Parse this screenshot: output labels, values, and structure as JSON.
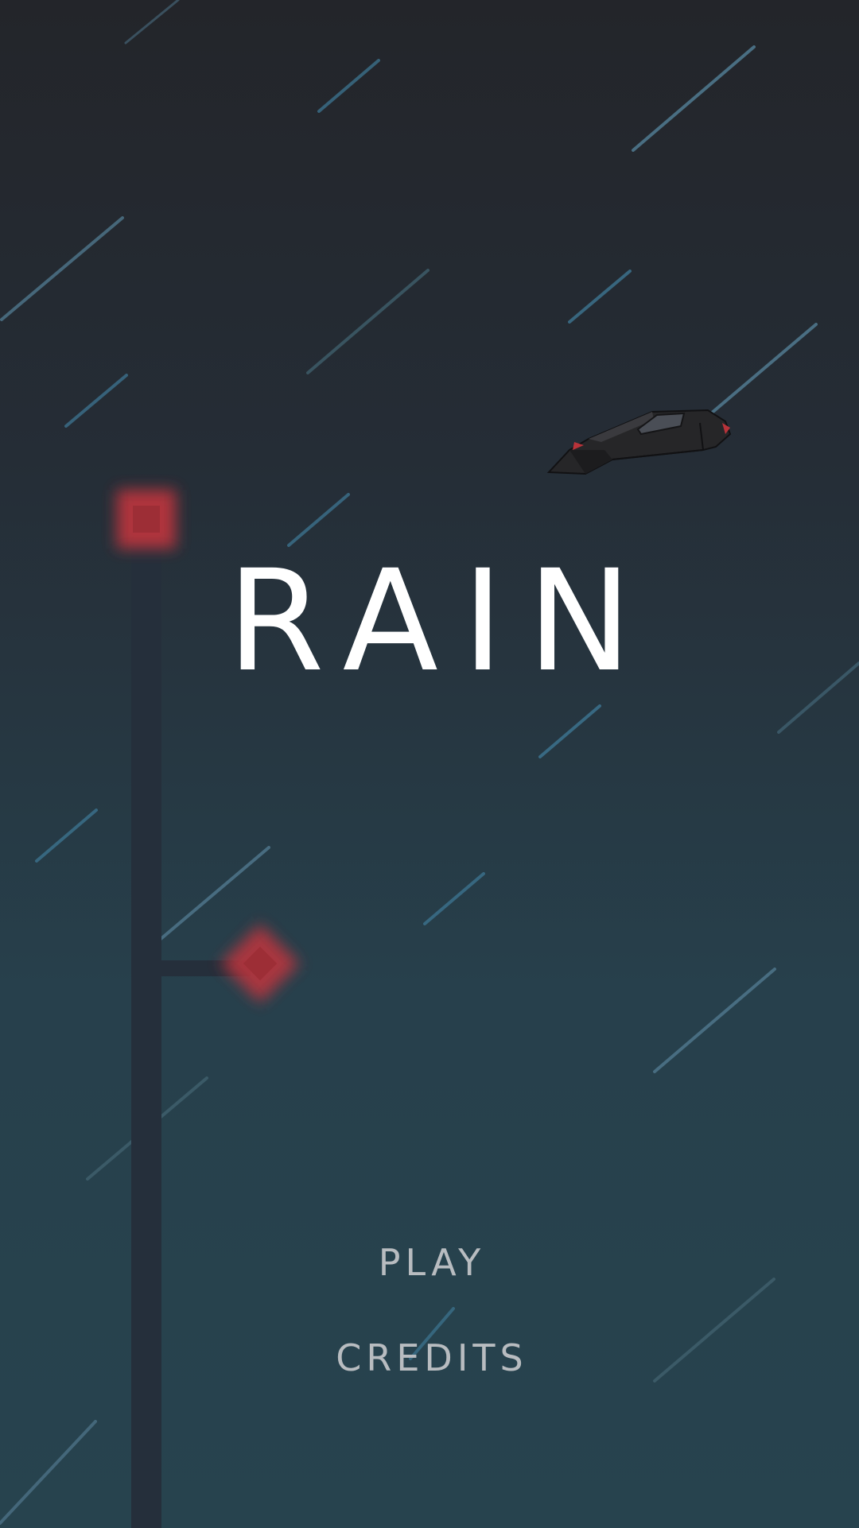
{
  "game": {
    "title": "RAIN"
  },
  "menu": {
    "play_label": "PLAY",
    "credits_label": "CREDITS"
  },
  "colors": {
    "background_top": "#23252a",
    "background_bottom": "#27434e",
    "rain": "#4c7287",
    "title_text": "#ffffff",
    "menu_text": "#b8bcc0",
    "warning_light": "#b8333a",
    "lamp_post": "#252f3b"
  },
  "scene": {
    "objects": [
      "lamp-post",
      "warning-light",
      "flying-car",
      "rain-streaks"
    ]
  }
}
